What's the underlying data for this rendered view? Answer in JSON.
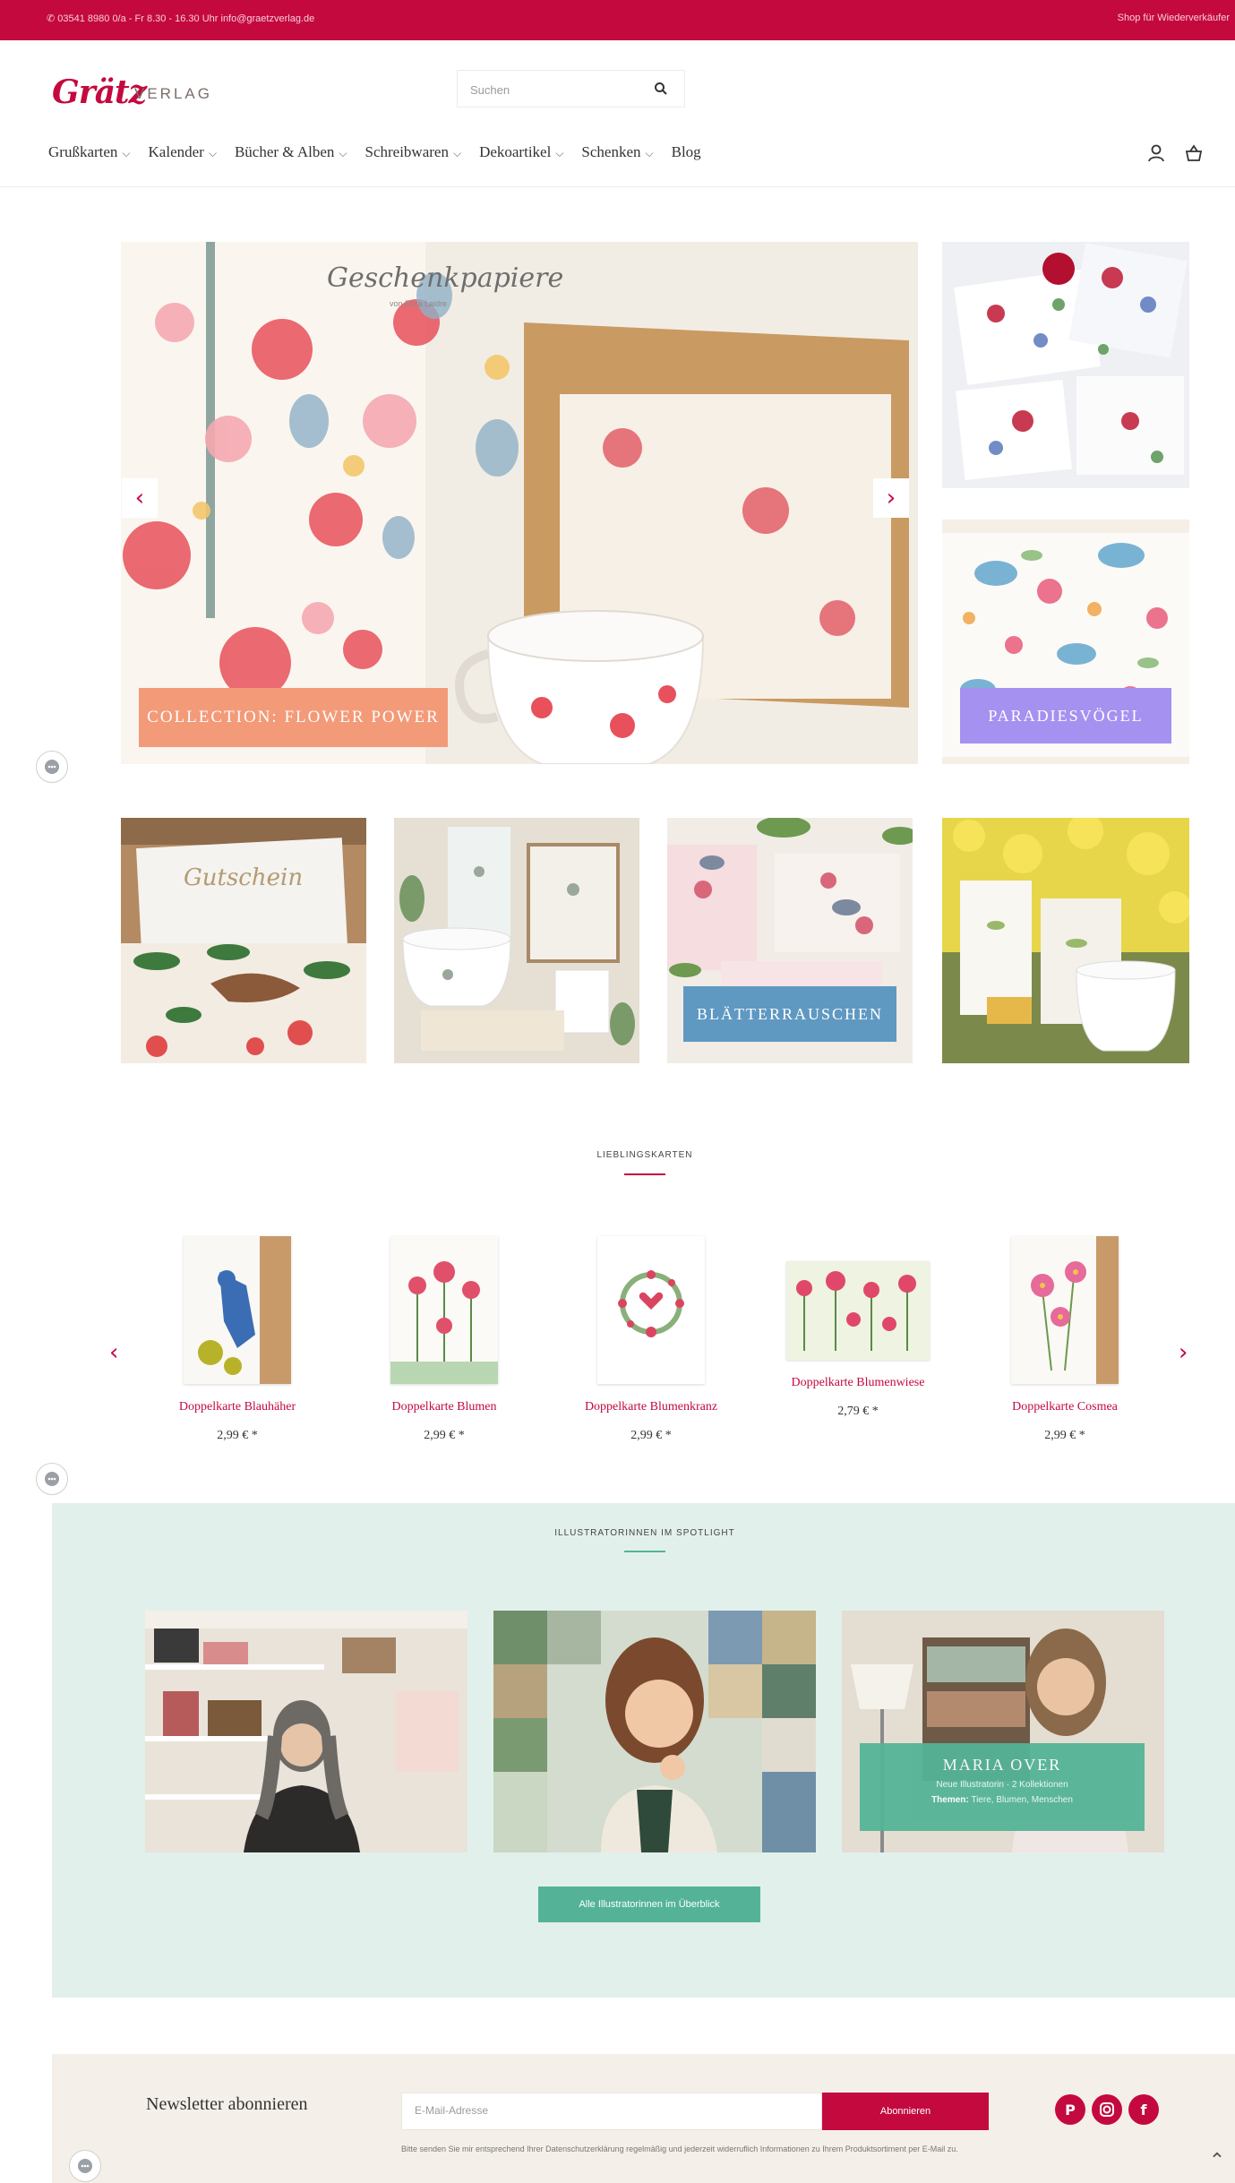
{
  "topbar": {
    "contact": "✆ 03541 8980 0/a - Fr 8.30 - 16.30 Uhr info@graetzverlag.de",
    "shop_for": "Shop für Wiederverkäufer"
  },
  "header": {
    "logo_word": "Grätz",
    "logo_suffix": "VERLAG",
    "search_placeholder": "Suchen"
  },
  "nav": {
    "items": [
      {
        "label": "Grußkarten",
        "dropdown": true
      },
      {
        "label": "Kalender",
        "dropdown": true
      },
      {
        "label": "Bücher & Alben",
        "dropdown": true
      },
      {
        "label": "Schreibwaren",
        "dropdown": true
      },
      {
        "label": "Dekoartikel",
        "dropdown": true
      },
      {
        "label": "Schenken",
        "dropdown": true
      },
      {
        "label": "Blog",
        "dropdown": false
      }
    ],
    "icons": [
      "account-icon",
      "basket-icon"
    ]
  },
  "hero": {
    "slide_title": "Geschenkpapiere",
    "slide_subtitle": "von Eliza Laidre",
    "label": "COLLECTION: FLOWER POWER",
    "side_label": "PARADIESVÖGEL",
    "prev_icon": "chevron-left-icon",
    "next_icon": "chevron-right-icon"
  },
  "tiles": {
    "gutschein_text": "Gutschein",
    "blatt_label": "BLÄTTERRAUSCHEN"
  },
  "favorites": {
    "title": "LIEBLINGSKARTEN",
    "products": [
      {
        "name": "Doppelkarte Blauhäher",
        "price": "2,99 € *"
      },
      {
        "name": "Doppelkarte Blumen",
        "price": "2,99 € *"
      },
      {
        "name": "Doppelkarte Blumenkranz",
        "price": "2,99 € *"
      },
      {
        "name": "Doppelkarte Blumenwiese",
        "price": "2,79 € *"
      },
      {
        "name": "Doppelkarte Cosmea",
        "price": "2,99 € *"
      }
    ]
  },
  "spotlight": {
    "title": "ILLUSTRATORINNEN IM SPOTLIGHT",
    "featured_name": "MARIA OVER",
    "featured_line1": "Neue Illustratorin · 2 Kollektionen",
    "featured_themes_label": "Themen:",
    "featured_themes": "Tiere, Blumen, Menschen",
    "button": "Alle Illustratorinnen im Überblick"
  },
  "newsletter": {
    "title": "Newsletter abonnieren",
    "email_placeholder": "E-Mail-Adresse",
    "button": "Abonnieren",
    "note": "Bitte senden Sie mir entsprechend Ihrer Datenschutzerklärung regelmäßig und jederzeit widerruflich Informationen zu Ihrem Produktsortiment per E-Mail zu."
  },
  "colors": {
    "brand": "#c4093f",
    "salmon": "#f39a78",
    "lavender": "#a591f0",
    "blue": "#5f99c2",
    "mint": "#54b396",
    "mint_bg": "#e2f0eb",
    "cream_bg": "#f4f0e9"
  }
}
